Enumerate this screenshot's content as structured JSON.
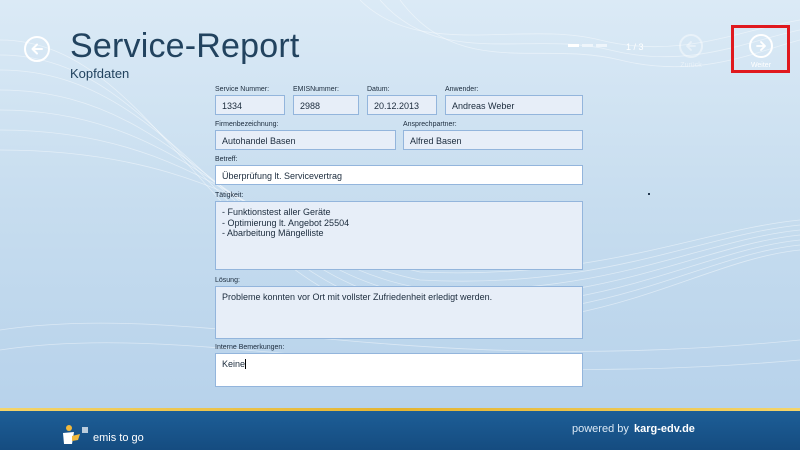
{
  "header": {
    "title": "Service-Report",
    "subtitle": "Kopfdaten",
    "page_indicator": "1 / 3"
  },
  "nav": {
    "back_label": "Zurück",
    "next_label": "Weiter"
  },
  "fields": {
    "service_nummer": {
      "label": "Service Nummer:",
      "value": "1334"
    },
    "emis_nummer": {
      "label": "EMISNummer:",
      "value": "2988"
    },
    "datum": {
      "label": "Datum:",
      "value": "20.12.2013"
    },
    "anwender": {
      "label": "Anwender:",
      "value": "Andreas Weber"
    },
    "firmenbezeichnung": {
      "label": "Firmenbezeichnung:",
      "value": "Autohandel Basen"
    },
    "ansprechpartner": {
      "label": "Ansprechpartner:",
      "value": "Alfred Basen"
    },
    "betreff": {
      "label": "Betreff:",
      "value": "Überprüfung lt. Servicevertrag"
    },
    "taetigkeit": {
      "label": "Tätigkeit:",
      "value": "- Funktionstest aller Geräte\n- Optimierung lt. Angebot 25504\n- Abarbeitung Mängelliste"
    },
    "loesung": {
      "label": "Lösung:",
      "value": "Probleme konnten vor Ort mit vollster Zufriedenheit erledigt werden."
    },
    "interne_bemerkungen": {
      "label": "Interne Bemerkungen:",
      "value": "Keine"
    }
  },
  "footer": {
    "logo_text": "emis to go",
    "powered_by": "powered by",
    "powered_url": "karg-edv.de"
  },
  "colors": {
    "accent_red": "#e0191e",
    "footer_blue": "#1d5e97",
    "field_border": "#93b5dc"
  }
}
